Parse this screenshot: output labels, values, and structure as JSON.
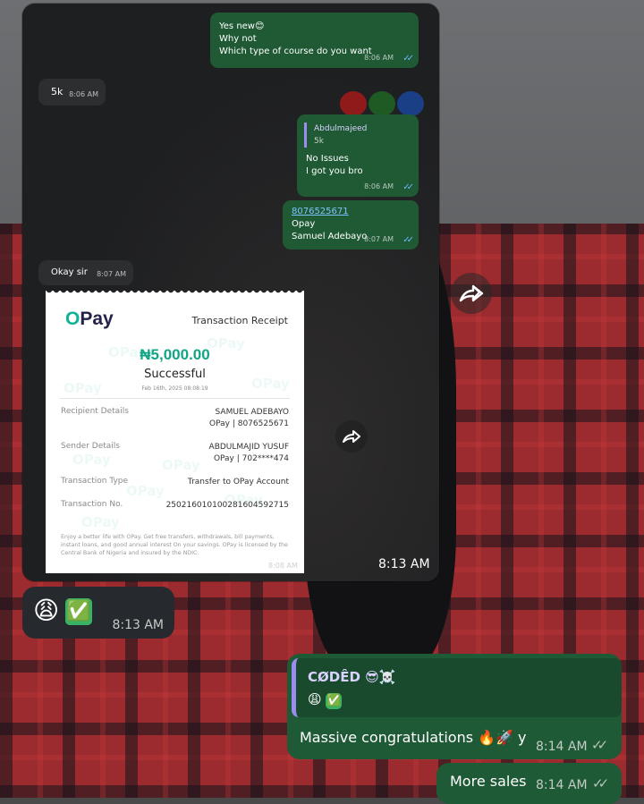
{
  "forwarded_screenshot": {
    "messages": [
      {
        "dir": "out",
        "lines": [
          "Yes new😊",
          "Why not",
          "Which type of course do you want"
        ],
        "time": "8:06 AM"
      },
      {
        "dir": "in",
        "lines": [
          "5k"
        ],
        "time": "8:06 AM"
      },
      {
        "dir": "out",
        "quote": {
          "name": "Abdulmajeed",
          "text": "5k"
        },
        "lines": [
          "No Issues",
          "I got you bro"
        ],
        "time": "8:06 AM"
      },
      {
        "dir": "out",
        "link": "8076525671",
        "lines": [
          "Opay",
          "Samuel Adebayo"
        ],
        "time": "8:07 AM"
      },
      {
        "dir": "in",
        "lines": [
          "Okay sir"
        ],
        "time": "8:07 AM"
      }
    ],
    "receipt": {
      "brand": "Pay",
      "title": "Transaction Receipt",
      "amount": "₦5,000.00",
      "status": "Successful",
      "date": "Feb 16th, 2025 08:08:19",
      "recipient_label": "Recipient Details",
      "recipient_name": "SAMUEL ADEBAYO",
      "recipient_account": "OPay | 8076525671",
      "sender_label": "Sender Details",
      "sender_name": "ABDULMAJID YUSUF",
      "sender_account": "OPay | 702****474",
      "type_label": "Transaction Type",
      "type_value": "Transfer to OPay Account",
      "no_label": "Transaction No.",
      "no_value": "250216010100281604592715",
      "footer": "Enjoy a better life with OPay. Get free transfers, withdrawals, bill payments, instant loans, and good annual interest On your savings. OPay is licensed by the Central Bank of Nigeria and insured by the NDIC.",
      "watermark": "OPay"
    },
    "receipt_time": "8:08 AM",
    "time": "8:13 AM"
  },
  "messages": [
    {
      "id": "m1",
      "emoji": [
        "😩",
        "✅"
      ],
      "time": "8:13 AM"
    },
    {
      "id": "m2",
      "reply": {
        "name": "CØDÊD 😎☠️",
        "text": [
          "😩",
          "✅"
        ]
      },
      "text": "Massive congratulations 🔥🚀 y",
      "time": "8:14 AM"
    },
    {
      "id": "m3",
      "text": "More sales",
      "time": "8:14 AM"
    }
  ],
  "icons": {
    "forward": "forward-icon",
    "double_check": "double-check-icon"
  },
  "colors": {
    "outgoing": "#1e5a36",
    "incoming": "#262a2e",
    "link": "#7ec3ff",
    "opay_green": "#10b394",
    "quote_bar": "#9c8cf0"
  }
}
